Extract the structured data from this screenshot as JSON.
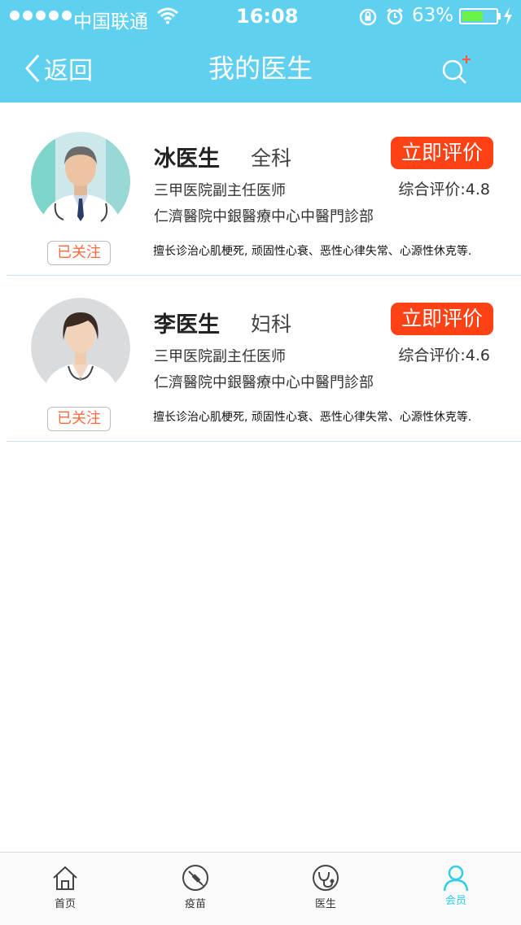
{
  "status_bar": {
    "carrier": "中国联通",
    "time": "16:08",
    "battery_percent_text": "63%",
    "battery_level": 0.63,
    "icons": [
      "signal-dots-icon",
      "wifi-icon",
      "rotation-lock-icon",
      "alarm-icon",
      "battery-icon",
      "charging-bolt-icon"
    ]
  },
  "nav": {
    "back_label": "返回",
    "title": "我的医生",
    "search_icon": "search-add-icon"
  },
  "colors": {
    "header_bg": "#5fd0ef",
    "rate_button_bg": "#ff4215",
    "follow_text": "#ff6a3d",
    "active_tab": "#2fcde8"
  },
  "doctors": [
    {
      "name": "冰医生",
      "department": "全科",
      "rate_button": "立即评价",
      "title": "三甲医院副主任医师",
      "rating": "综合评价:4.8",
      "hospital": "仁濟醫院中銀醫療中心中醫門診部",
      "follow_status": "已关注",
      "specialty": "擅长诊治心肌梗死, 顽固性心衰、恶性心律失常、心源性休克等..."
    },
    {
      "name": "李医生",
      "department": "妇科",
      "rate_button": "立即评价",
      "title": "三甲医院副主任医师",
      "rating": "综合评价:4.6",
      "hospital": "仁濟醫院中銀醫療中心中醫門診部",
      "follow_status": "已关注",
      "specialty": "擅长诊治心肌梗死, 顽固性心衰、恶性心律失常、心源性休克等..."
    }
  ],
  "tabs": [
    {
      "label": "首页",
      "icon": "home-icon",
      "active": false
    },
    {
      "label": "疫苗",
      "icon": "vaccine-icon",
      "active": false
    },
    {
      "label": "医生",
      "icon": "doctor-icon",
      "active": false
    },
    {
      "label": "会员",
      "icon": "member-icon",
      "active": true
    }
  ]
}
